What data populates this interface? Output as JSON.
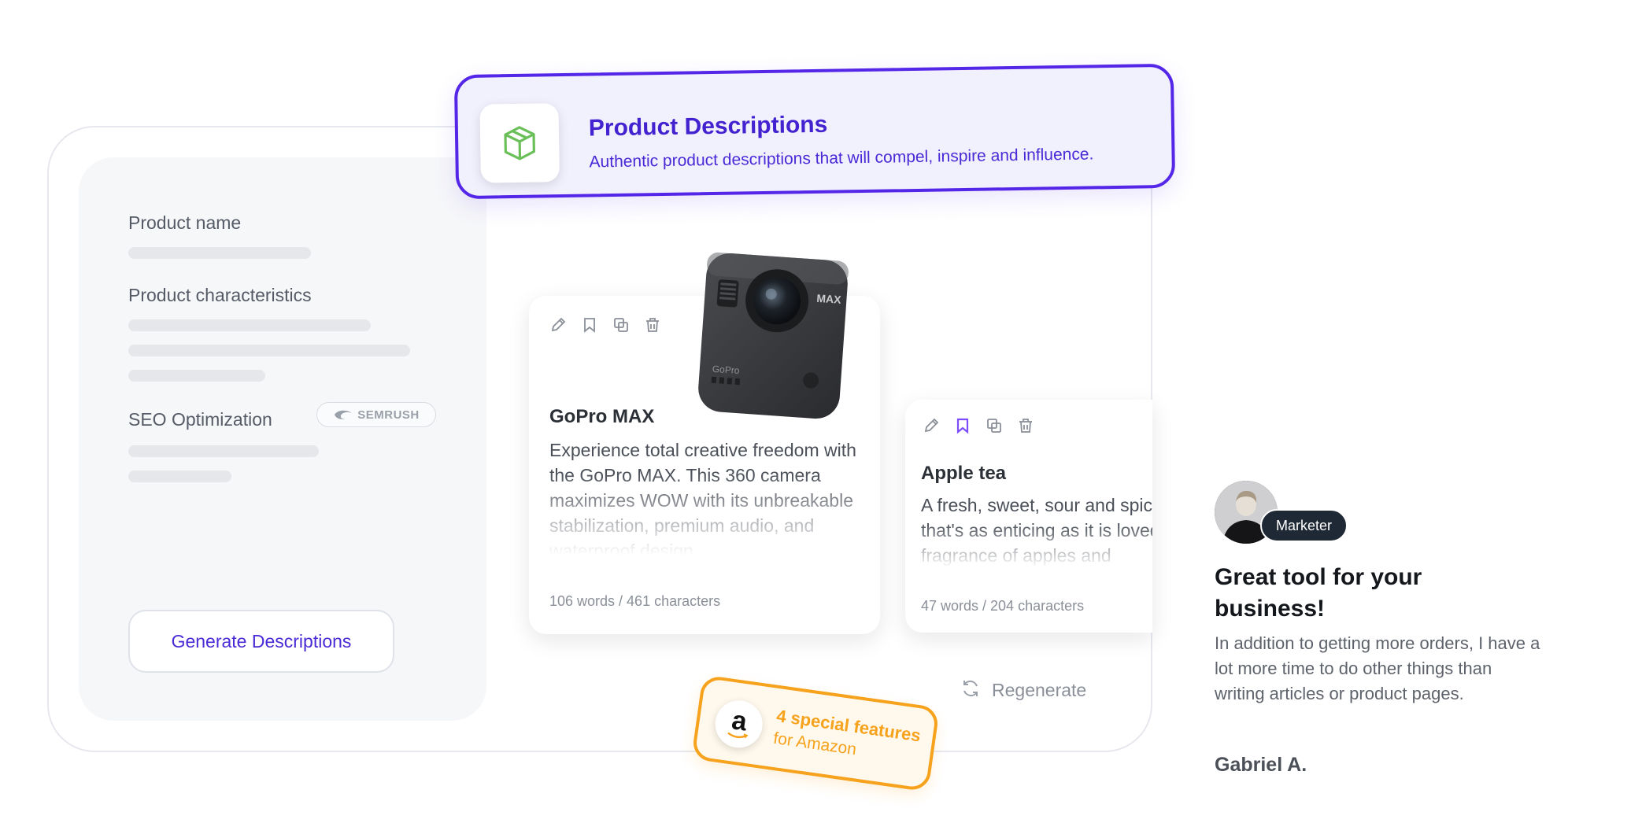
{
  "form": {
    "product_name_label": "Product name",
    "characteristics_label": "Product characteristics",
    "seo_label": "SEO Optimization",
    "semrush_badge": "SEMRUSH",
    "generate_button": "Generate Descriptions"
  },
  "banner": {
    "icon": "box-icon",
    "title": "Product Descriptions",
    "subtitle": "Authentic product descriptions that will compel, inspire and influence."
  },
  "cards": [
    {
      "title": "GoPro MAX",
      "text": "Experience total creative freedom with the GoPro MAX. This 360 camera maximizes WOW with its unbreakable stabilization, premium audio, and waterproof design.",
      "meta": "106 words / 461 characters",
      "bookmarked": false
    },
    {
      "title": "Apple tea",
      "text": "A fresh, sweet, sour and spicy that's as enticing as it is loved fragrance of apples and",
      "meta": "47 words / 204 characters",
      "bookmarked": true
    }
  ],
  "camera": {
    "brand_label": "MAX",
    "logo_text": "GoPro"
  },
  "amazon": {
    "logo_letter": "a",
    "line1": "4 special features",
    "line2": "for Amazon"
  },
  "regenerate_label": "Regenerate",
  "testimonial": {
    "role": "Marketer",
    "title": "Great tool for your business!",
    "body": "In addition to getting more orders, I have a lot more time to do other things than writing articles or product pages.",
    "author": "Gabriel A."
  },
  "colors": {
    "accent": "#5426e8",
    "amazon": "#f6a21c",
    "bookmark_active": "#7c4dff"
  }
}
